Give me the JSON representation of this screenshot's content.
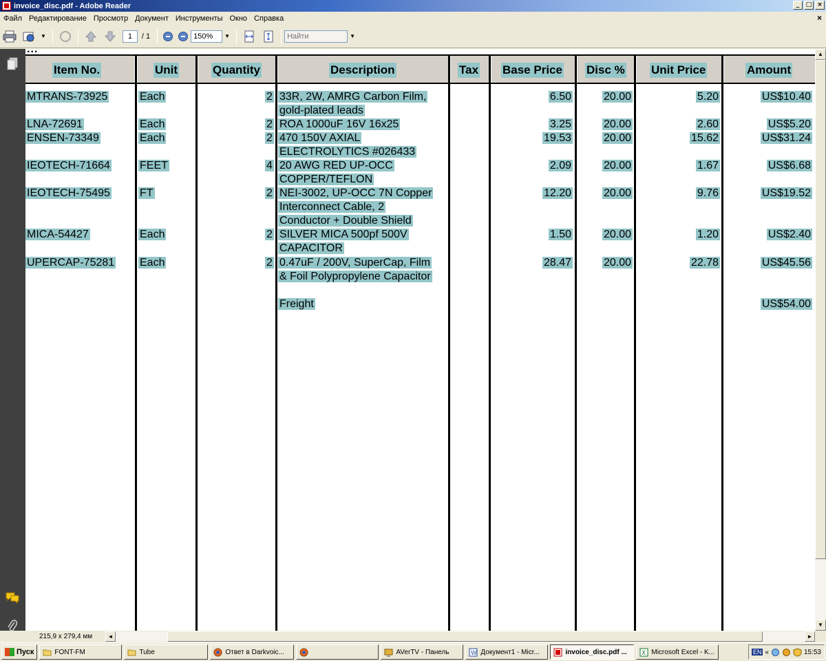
{
  "window": {
    "title": "invoice_disc.pdf - Adobe Reader",
    "min": "_",
    "max": "□",
    "close": "×"
  },
  "menu": [
    "Файл",
    "Редактирование",
    "Просмотр",
    "Документ",
    "Инструменты",
    "Окно",
    "Справка"
  ],
  "toolbar": {
    "page_current": "1",
    "page_total": "/ 1",
    "zoom": "150%",
    "search_placeholder": "Найти"
  },
  "status": {
    "page_size": "215,9 x 279,4 мм"
  },
  "invoice": {
    "top_partial": "...",
    "headers": {
      "item": "Item No.",
      "unit": "Unit",
      "quantity": "Quantity",
      "description": "Description",
      "tax": "Tax",
      "base_price": "Base Price",
      "disc": "Disc %",
      "unit_price": "Unit Price",
      "amount": "Amount"
    },
    "rows": [
      {
        "item": "MTRANS-73925",
        "unit": "Each",
        "qty": "2",
        "desc": [
          "33R, 2W, AMRG Carbon Film,",
          "gold-plated leads"
        ],
        "base": "6.50",
        "disc": "20.00",
        "unit_price": "5.20",
        "amount": "US$10.40"
      },
      {
        "item": "LNA-72691",
        "unit": "Each",
        "qty": "2",
        "desc": [
          "ROA 1000uF 16V 16x25"
        ],
        "base": "3.25",
        "disc": "20.00",
        "unit_price": "2.60",
        "amount": "US$5.20"
      },
      {
        "item": "ENSEN-73349",
        "unit": "Each",
        "qty": "2",
        "desc": [
          "470 150V AXIAL",
          "ELECTROLYTICS  #026433"
        ],
        "base": "19.53",
        "disc": "20.00",
        "unit_price": "15.62",
        "amount": "US$31.24"
      },
      {
        "item": "IEOTECH-71664",
        "unit": "FEET",
        "qty": "4",
        "desc": [
          "20 AWG RED UP-OCC",
          "COPPER/TEFLON"
        ],
        "base": "2.09",
        "disc": "20.00",
        "unit_price": "1.67",
        "amount": "US$6.68"
      },
      {
        "item": "IEOTECH-75495",
        "unit": "FT",
        "qty": "2",
        "desc": [
          "NEI-3002, UP-OCC 7N Copper",
          "Interconnect Cable, 2",
          "Conductor + Double Shield"
        ],
        "base": "12.20",
        "disc": "20.00",
        "unit_price": "9.76",
        "amount": "US$19.52"
      },
      {
        "item": "MICA-54427",
        "unit": "Each",
        "qty": "2",
        "desc": [
          "SILVER MICA 500pf 500V",
          "CAPACITOR"
        ],
        "base": "1.50",
        "disc": "20.00",
        "unit_price": "1.20",
        "amount": "US$2.40"
      },
      {
        "item": "UPERCAP-75281",
        "unit": "Each",
        "qty": "2",
        "desc": [
          "0.47uF / 200V, SuperCap, Film",
          "& Foil Polypropylene Capacitor"
        ],
        "base": "28.47",
        "disc": "20.00",
        "unit_price": "22.78",
        "amount": "US$45.56"
      }
    ],
    "freight": {
      "label": "Freight",
      "amount": "US$54.00"
    }
  },
  "taskbar": {
    "start": "Пуск",
    "tasks": [
      {
        "label": "FONT-FM",
        "icon": "folder-icon",
        "active": false
      },
      {
        "label": "Tube",
        "icon": "folder-icon",
        "active": false
      },
      {
        "label": "Ответ в Darkvoic...",
        "icon": "firefox-icon",
        "active": false
      },
      {
        "label": "",
        "icon": "firefox-icon",
        "active": false
      },
      {
        "label": "AVerTV - Панель",
        "icon": "tv-icon",
        "active": false
      },
      {
        "label": "Документ1 - Micr...",
        "icon": "word-icon",
        "active": false
      },
      {
        "label": "invoice_disc.pdf ...",
        "icon": "pdf-icon",
        "active": true
      },
      {
        "label": "Microsoft Excel - K...",
        "icon": "excel-icon",
        "active": false
      }
    ],
    "lang": "EN",
    "chevron": "«",
    "clock": "15:53"
  }
}
